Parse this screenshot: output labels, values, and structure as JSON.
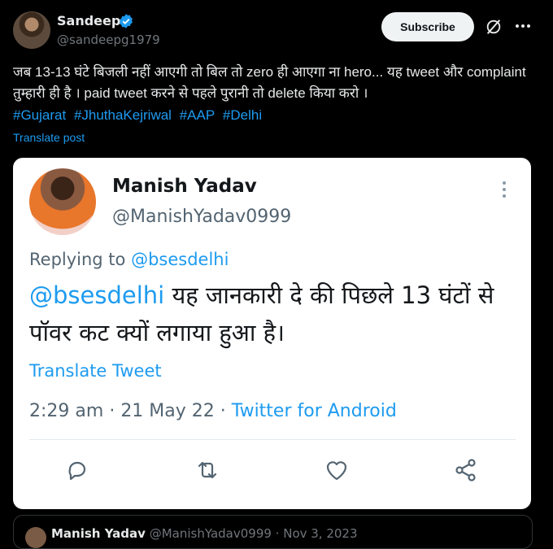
{
  "post": {
    "author_name": "Sandeep",
    "author_handle": "@sandeepg1979",
    "subscribe_label": "Subscribe",
    "text": "जब 13-13 घंटे बिजली नहीं आएगी तो बिल तो zero ही आएगा ना hero... यह tweet और complaint तुम्हारी ही है । paid tweet करने से पहले पुरानी तो delete किया करो ।",
    "hashtags": [
      "#Gujarat",
      "#JhuthaKejriwal",
      "#AAP",
      "#Delhi"
    ],
    "translate_label": "Translate post"
  },
  "embedded_tweet": {
    "name": "Manish Yadav",
    "handle": "@ManishYadav0999",
    "replying_prefix": "Replying to",
    "replying_to": "@bsesdelhi",
    "mention": "@bsesdelhi",
    "text": "यह जानकारी दे की पिछले 13 घंटों से पॉवर कट क्यों लगाया हुआ है।",
    "translate_label": "Translate Tweet",
    "time": "2:29 am",
    "date": "21 May 22",
    "separator": "·",
    "source": "Twitter for Android"
  },
  "quote_preview": {
    "name": "Manish Yadav",
    "rest": "@ManishYadav0999 · Nov 3, 2023"
  },
  "icons": {
    "verified": "verified-badge-icon",
    "grok": "grok-icon",
    "more": "more-icon",
    "reply": "reply-icon",
    "retweet": "retweet-icon",
    "like": "like-icon",
    "share": "share-icon"
  },
  "colors": {
    "accent": "#1d9bf0",
    "background": "#000000",
    "card": "#ffffff"
  }
}
